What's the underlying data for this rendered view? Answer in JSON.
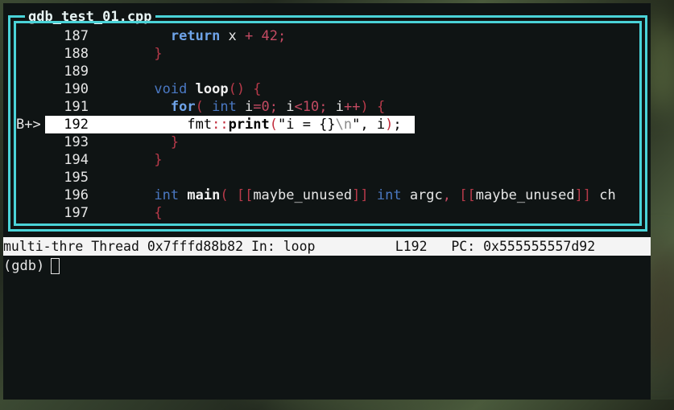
{
  "window": {
    "title": "gdb_test_01.cpp"
  },
  "source_lines": [
    {
      "bp": "",
      "num": "187"
    },
    {
      "bp": "",
      "num": "188"
    },
    {
      "bp": "",
      "num": "189"
    },
    {
      "bp": "",
      "num": "190"
    },
    {
      "bp": "",
      "num": "191"
    },
    {
      "bp": "B+>",
      "num": "192"
    },
    {
      "bp": "",
      "num": "193"
    },
    {
      "bp": "",
      "num": "194"
    },
    {
      "bp": "",
      "num": "195"
    },
    {
      "bp": "",
      "num": "196"
    },
    {
      "bp": "",
      "num": "197"
    }
  ],
  "code": {
    "l187": {
      "kw": "return",
      "rest1": " x ",
      "op": "+",
      "num": " 42",
      "end": ";"
    },
    "l188": {
      "brace": "}"
    },
    "l190": {
      "kw": "void",
      "fn": "loop",
      "paren": "()",
      "brace": " {"
    },
    "l191": {
      "kw": "for",
      "p1": "(",
      "t": " int",
      "a": " i",
      "eq": "=",
      "z": "0",
      "s1": ";",
      "b": " i",
      "lt": "<",
      "ten": "10",
      "s2": ";",
      "c": " i",
      "pp": "++",
      "p2": ")",
      "brace": " {"
    },
    "l192": {
      "ns": "fmt",
      "sc": "::",
      "fn": "print",
      "p1": "(",
      "str": "\"i = {}",
      "esc": "\\n",
      "q": "\"",
      "rest": ", i",
      "p2": ")",
      "semi": ";"
    },
    "l193": {
      "brace": "}"
    },
    "l194": {
      "brace": "}"
    },
    "l196": {
      "t": "int",
      "fn": "main",
      "p1": "(",
      "a1": " [[",
      "attr1": "maybe_unused",
      "a2": "]]",
      "t2": " int",
      "arg": " argc",
      "comma": ",",
      "a3": " [[",
      "attr2": "maybe_unused",
      "a4": "]]",
      "ch": " ch"
    },
    "l197": {
      "brace": "{"
    }
  },
  "status": {
    "target": "multi-thre",
    "thread": "Thread 0x7fffd88b82",
    "func": "In: loop",
    "line": "L192",
    "pc": "PC: 0x555555557d92"
  },
  "prompt": {
    "text": "(gdb)"
  }
}
